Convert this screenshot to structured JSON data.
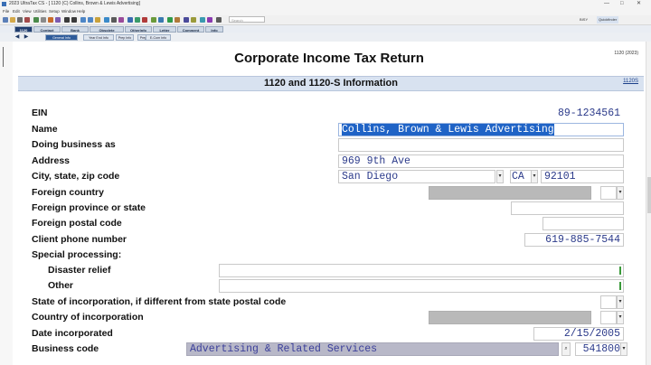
{
  "window": {
    "title": "2023 UltraTax CS - [ 1120 (C) Collins, Brown & Lewis Advertising]",
    "controls": [
      "—",
      "□",
      "✕"
    ]
  },
  "menu": [
    "File",
    "Edit",
    "View",
    "Utilities",
    "Setup",
    "Window",
    "Help"
  ],
  "toolbar": {
    "search_placeholder": "Search",
    "right_items": [
      "BISY",
      "Quickfinder"
    ]
  },
  "tabs": [
    {
      "label": "1120",
      "active": true
    },
    {
      "label": "Contact",
      "active": false
    },
    {
      "label": "Bank",
      "active": false
    },
    {
      "label": "Obsolete",
      "active": false
    },
    {
      "label": "OtherInfo",
      "active": false
    },
    {
      "label": "Letter",
      "active": false
    },
    {
      "label": "Comment",
      "active": false
    },
    {
      "label": "Info",
      "active": false
    }
  ],
  "subtabs": [
    {
      "label": "General Info",
      "active": true
    },
    {
      "label": "Year End Info",
      "active": false
    },
    {
      "label": "Prep Info",
      "active": false
    },
    {
      "label": "Prep Info",
      "active": false
    },
    {
      "label": "E-Com Info",
      "active": false
    }
  ],
  "form": {
    "title": "Corporate Income Tax Return",
    "form_id": "1120 (2023)",
    "section_title": "1120 and 1120-S Information",
    "section_link": "1120S"
  },
  "fields": {
    "ein": {
      "label": "EIN",
      "value": "89-1234561"
    },
    "name": {
      "label": "Name",
      "value": "Collins, Brown & Lewis Advertising"
    },
    "dba": {
      "label": "Doing business as",
      "value": ""
    },
    "address": {
      "label": "Address",
      "value": "969 9th Ave"
    },
    "city_state_zip": {
      "label": "City, state, zip code",
      "city": "San Diego",
      "state": "CA",
      "zip": "92101"
    },
    "foreign_country": {
      "label": "Foreign country",
      "value": ""
    },
    "foreign_province": {
      "label": "Foreign province or state",
      "value": ""
    },
    "foreign_postal": {
      "label": "Foreign postal code",
      "value": ""
    },
    "phone": {
      "label": "Client phone number",
      "value": "619-885-7544"
    },
    "special_processing": {
      "label": "Special processing:"
    },
    "disaster_relief": {
      "label": "Disaster relief",
      "value": ""
    },
    "other": {
      "label": "Other",
      "value": ""
    },
    "state_incorp": {
      "label": "State of incorporation, if different from state postal code",
      "value": ""
    },
    "country_incorp": {
      "label": "Country of incorporation",
      "value": ""
    },
    "date_incorp": {
      "label": "Date incorporated",
      "value": "2/15/2005"
    },
    "business_code": {
      "label": "Business code",
      "description": "Advertising & Related Services",
      "code": "541800"
    }
  },
  "colors": {
    "selection": "#1f63c6",
    "section_bar": "#d8e2f0",
    "field_text": "#2b3a8a",
    "gray_field": "#b9b9b9"
  }
}
